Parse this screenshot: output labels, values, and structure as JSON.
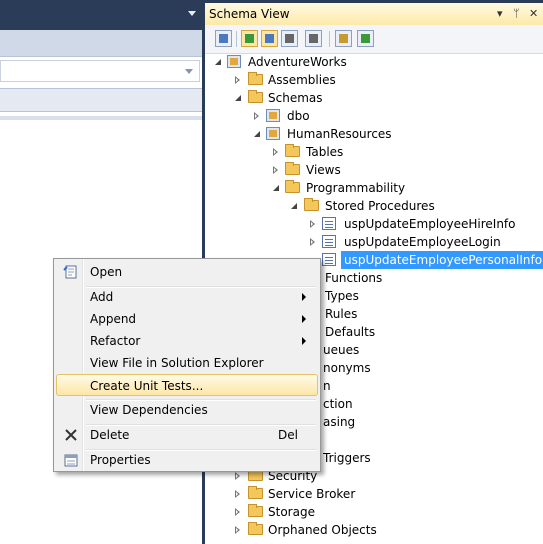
{
  "schema_view": {
    "title": "Schema View",
    "header_buttons": {
      "dropdown": "▾",
      "pin": "ᛘ",
      "close": "✕"
    },
    "tree": {
      "root": "AdventureWorks",
      "assemblies": "Assemblies",
      "schemas": "Schemas",
      "dbo": "dbo",
      "human_resources": "HumanResources",
      "tables": "Tables",
      "views": "Views",
      "programmability": "Programmability",
      "stored_procedures": "Stored Procedures",
      "sp1": "uspUpdateEmployeeHireInfo",
      "sp2": "uspUpdateEmployeeLogin",
      "sp3": "uspUpdateEmployeePersonalInfo",
      "functions": "Functions",
      "types": "Types",
      "rules": "Rules",
      "defaults": "Defaults",
      "queues_partial": "ueues",
      "synonyms_partial": "nonyms",
      "n_partial": "n",
      "ction_partial": "ction",
      "asing_partial": "asing",
      "triggers_partial": "Triggers",
      "security": "Security",
      "service_broker": "Service Broker",
      "storage": "Storage",
      "orphaned": "Orphaned Objects"
    }
  },
  "context_menu": {
    "items": [
      {
        "label": "Open",
        "icon": "open-icon"
      },
      {
        "label": "Add",
        "submenu": true
      },
      {
        "label": "Append",
        "submenu": true
      },
      {
        "label": "Refactor",
        "submenu": true
      },
      {
        "label": "View File in Solution Explorer"
      },
      {
        "label": "Create Unit Tests...",
        "highlighted": true
      },
      {
        "label": "View Dependencies"
      },
      {
        "label": "Delete",
        "shortcut": "Del",
        "icon": "delete-icon"
      },
      {
        "label": "Properties",
        "icon": "properties-icon"
      }
    ]
  },
  "colors": {
    "ide_background": "#2b3c59",
    "selection": "#3399ff",
    "menu_highlight": "#fde7a6"
  }
}
